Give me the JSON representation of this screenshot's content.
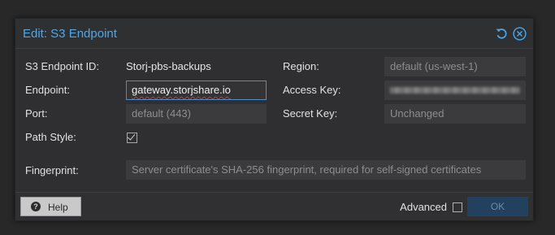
{
  "dialog": {
    "title": "Edit: S3 Endpoint",
    "reset_icon": "reset-icon",
    "close_icon": "close-icon"
  },
  "form": {
    "endpoint_id": {
      "label": "S3 Endpoint ID:",
      "value": "Storj-pbs-backups"
    },
    "endpoint": {
      "label": "Endpoint:",
      "value": "gateway.storjshare.io"
    },
    "port": {
      "label": "Port:",
      "placeholder": "default (443)"
    },
    "path_style": {
      "label": "Path Style:",
      "checked": true
    },
    "region": {
      "label": "Region:",
      "placeholder": "default (us-west-1)"
    },
    "access_key": {
      "label": "Access Key:",
      "value_hidden": true
    },
    "secret_key": {
      "label": "Secret Key:",
      "placeholder": "Unchanged"
    },
    "fingerprint": {
      "label": "Fingerprint:",
      "placeholder": "Server certificate's SHA-256 fingerprint, required for self-signed certificates"
    }
  },
  "footer": {
    "help_label": "Help",
    "help_icon": "question-circle-icon",
    "advanced_label": "Advanced",
    "advanced_checked": false,
    "ok_label": "OK"
  },
  "colors": {
    "title": "#4fa7e8",
    "accent_border": "#4a8fd0",
    "ok_button": "#22415f"
  }
}
